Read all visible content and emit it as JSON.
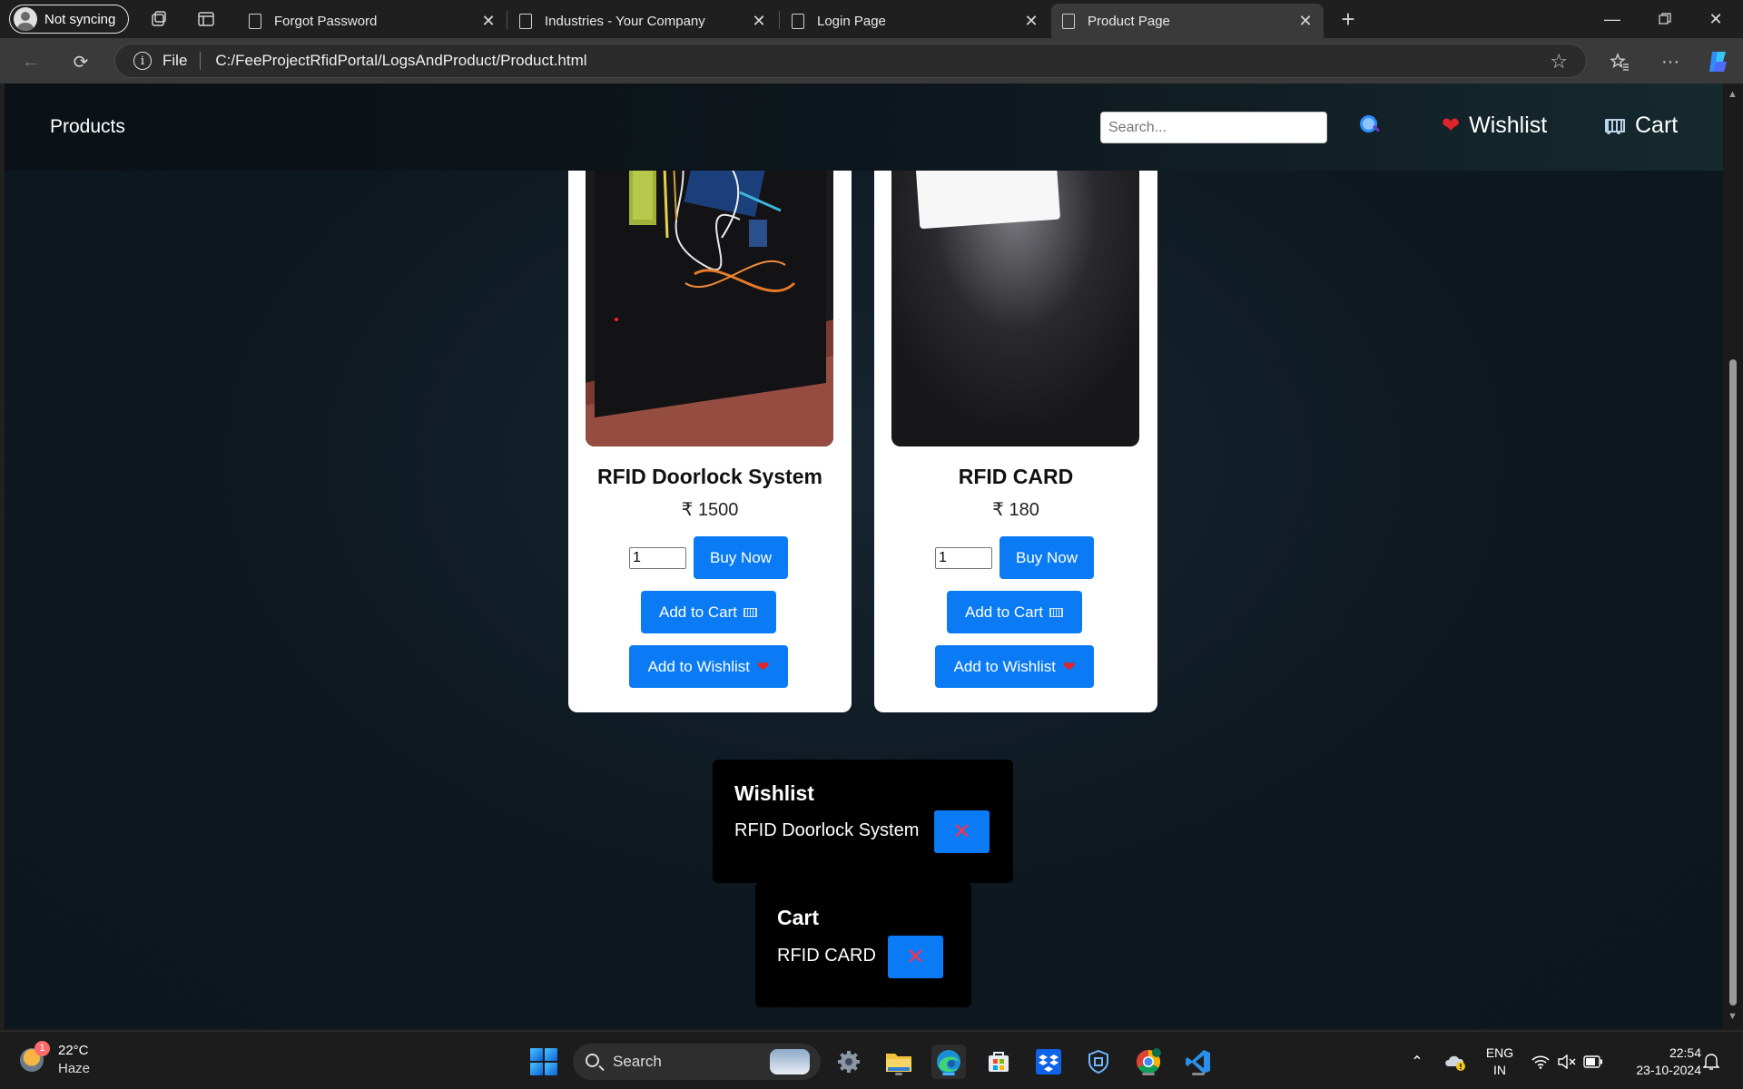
{
  "browser": {
    "profile_label": "Not syncing",
    "tabs": [
      {
        "title": "Forgot Password"
      },
      {
        "title": "Industries - Your Company"
      },
      {
        "title": "Login Page"
      },
      {
        "title": "Product Page"
      }
    ],
    "address_scheme": "File",
    "address_url": "C:/FeeProjectRfidPortal/LogsAndProduct/Product.html"
  },
  "site": {
    "brand": "Products",
    "search_placeholder": "Search...",
    "search_icon": "magnifying-glass-icon",
    "wishlist_label": "Wishlist",
    "cart_label": "Cart"
  },
  "products": [
    {
      "name": "RFID Doorlock System",
      "price": "₹ 1500",
      "qty": "1",
      "buy_label": "Buy Now",
      "cart_label": "Add to Cart",
      "wishlist_label": "Add to Wishlist"
    },
    {
      "name": "RFID CARD",
      "price": "₹ 180",
      "qty": "1",
      "buy_label": "Buy Now",
      "cart_label": "Add to Cart",
      "wishlist_label": "Add to Wishlist"
    }
  ],
  "wishlist_panel": {
    "title": "Wishlist",
    "items": [
      "RFID Doorlock System"
    ],
    "remove_glyph": "✕"
  },
  "cart_panel": {
    "title": "Cart",
    "items": [
      "RFID CARD"
    ],
    "remove_glyph": "✕"
  },
  "taskbar": {
    "weather_badge": "1",
    "temperature": "22°C",
    "condition": "Haze",
    "search_label": "Search",
    "lang_top": "ENG",
    "lang_bottom": "IN",
    "time": "22:54",
    "date": "23-10-2024"
  },
  "colors": {
    "accent_button": "#0a7bf5",
    "remove_x": "#ff2f4d",
    "heart": "#e0242b"
  }
}
